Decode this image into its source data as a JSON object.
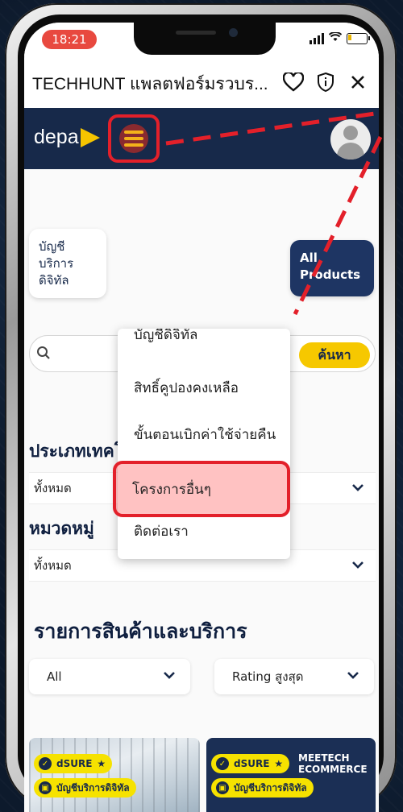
{
  "status_bar": {
    "time": "18:21"
  },
  "browser": {
    "title": "TECHHUNT แพลตฟอร์มรวบร..."
  },
  "nav": {
    "logo_text": "depa"
  },
  "tabs": [
    {
      "label": "บัญชี\nบริการ\nดิจิทัล"
    },
    {
      "label": "All\nProducts"
    }
  ],
  "menu": {
    "cut_item": "บัญชีดิจิทัล",
    "items": [
      {
        "label": "สิทธิ์คูปองคงเหลือ"
      },
      {
        "label": "ขั้นตอนเบิกค่าใช้จ่ายคืน"
      },
      {
        "label": "โครงการอื่นๆ"
      },
      {
        "label": "ติดต่อเรา"
      }
    ]
  },
  "search": {
    "button_label": "ค้นหา",
    "placeholder": ""
  },
  "filters": {
    "tech_type": {
      "heading": "ประเภทเทคโนโลยี",
      "value": "ทั้งหมด"
    },
    "category": {
      "heading": "หมวดหมู่",
      "value": "ทั้งหมด"
    }
  },
  "products": {
    "heading": "รายการสินค้าและบริการ",
    "filter_all": "All",
    "sort": "Rating สูงสุด"
  },
  "cards": [
    {
      "badge1": "dSURE",
      "badge2": "บัญชีบริการดิจิทัล"
    },
    {
      "badge1": "dSURE",
      "badge2": "บัญชีบริการดิจิทัล",
      "title": "MEETECH\nECOMMERCE"
    }
  ],
  "colors": {
    "navy": "#17294a",
    "accent_yellow": "#f6c800",
    "annotation_red": "#e3202a"
  }
}
